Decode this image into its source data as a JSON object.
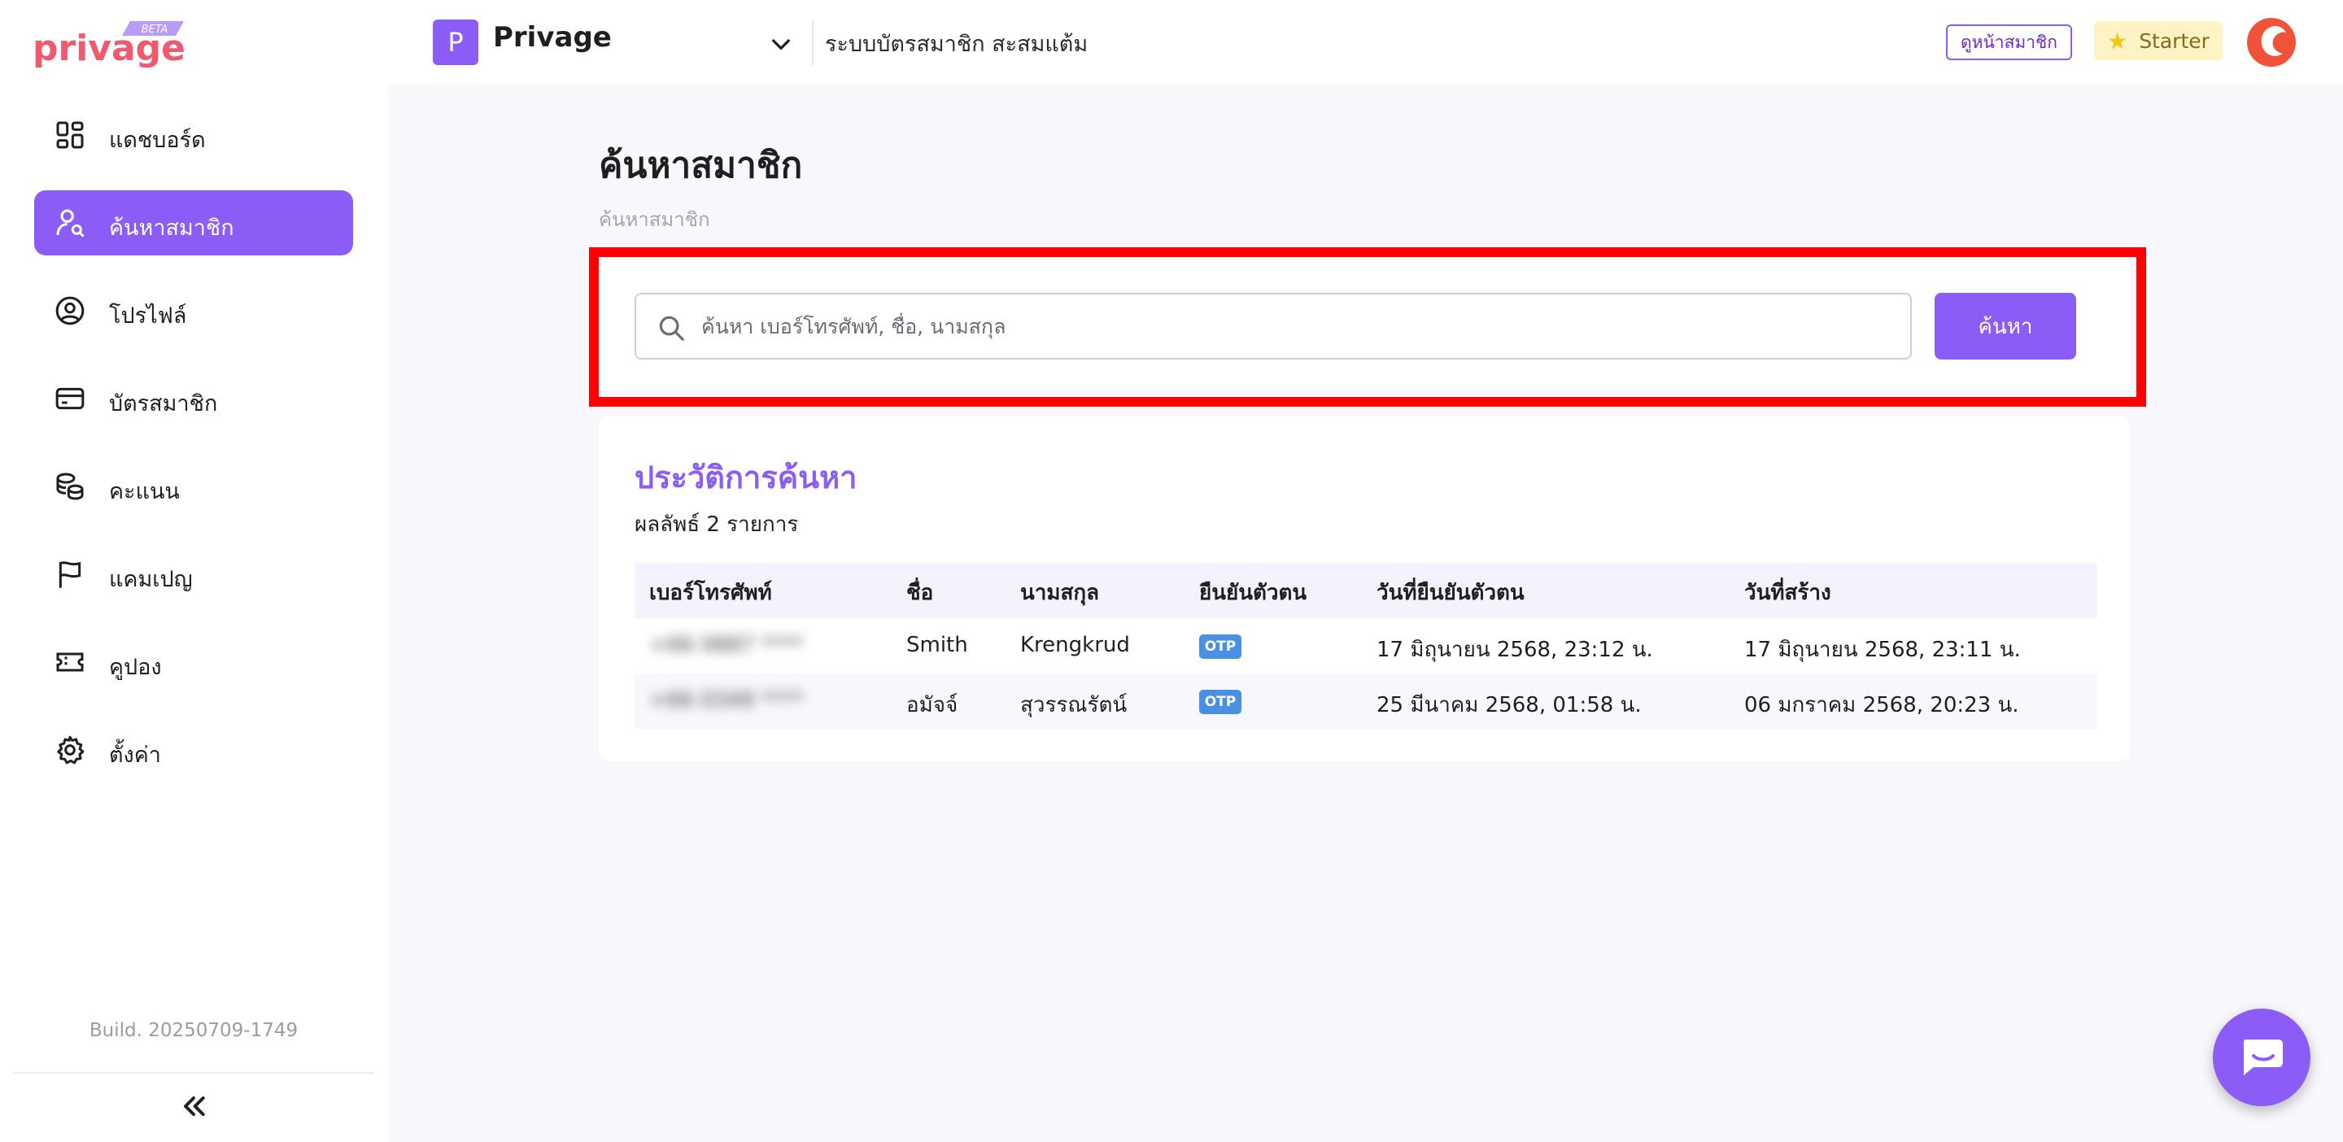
{
  "brand": {
    "logo_text": "privage",
    "beta_label": "BETA"
  },
  "header": {
    "workspace_initial": "P",
    "workspace_name": "Privage",
    "workspace_description": "ระบบบัตรสมาชิก สะสมแต้ม",
    "member_page_link": "ดูหน้าสมาชิก",
    "plan_label": "Starter"
  },
  "sidebar": {
    "items": [
      {
        "label": "แดชบอร์ด",
        "icon": "dashboard-icon"
      },
      {
        "label": "ค้นหาสมาชิก",
        "icon": "user-search-icon",
        "active": true
      },
      {
        "label": "โปรไฟล์",
        "icon": "profile-icon"
      },
      {
        "label": "บัตรสมาชิก",
        "icon": "card-icon"
      },
      {
        "label": "คะแนน",
        "icon": "coins-icon"
      },
      {
        "label": "แคมเปญ",
        "icon": "flag-icon"
      },
      {
        "label": "คูปอง",
        "icon": "ticket-icon"
      },
      {
        "label": "ตั้งค่า",
        "icon": "gear-icon"
      }
    ],
    "build": "Build. 20250709-1749"
  },
  "main": {
    "title": "ค้นหาสมาชิก",
    "breadcrumb": "ค้นหาสมาชิก",
    "search": {
      "placeholder": "ค้นหา เบอร์โทรศัพท์, ชื่อ, นามสกุล",
      "value": "",
      "button_label": "ค้นหา"
    },
    "history": {
      "title": "ประวัติการค้นหา",
      "count_text": "ผลลัพธ์ 2 รายการ",
      "columns": [
        "เบอร์โทรศัพท์",
        "ชื่อ",
        "นามสกุล",
        "ยืนยันตัวตน",
        "วันที่ยืนยันตัวตน",
        "วันที่สร้าง"
      ],
      "rows": [
        {
          "phone": "+66 0887 **** ",
          "first_name": "Smith",
          "last_name": "Krengkrud",
          "verify": "OTP",
          "verified_at": "17 มิถุนายน 2568, 23:12 น.",
          "created_at": "17 มิถุนายน 2568, 23:11 น."
        },
        {
          "phone": "+66 0349 **** ",
          "first_name": "อมัจจ์",
          "last_name": "สุวรรณรัตน์",
          "verify": "OTP",
          "verified_at": "25 มีนาคม 2568, 01:58 น.",
          "created_at": "06 มกราคม 2568, 20:23 น."
        }
      ]
    }
  },
  "colors": {
    "accent": "#8b5cf6",
    "highlight": "#ff0000",
    "otp_badge": "#4a90e2"
  }
}
